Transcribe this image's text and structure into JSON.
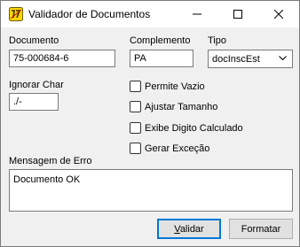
{
  "window": {
    "title": "Validador de Documentos",
    "icon": "app-logo-icon"
  },
  "titlebar_buttons": [
    "minimize-icon",
    "maximize-icon",
    "close-icon"
  ],
  "fields": {
    "documento": {
      "label": "Documento",
      "value": "75-000684-6"
    },
    "complemento": {
      "label": "Complemento",
      "value": "PA"
    },
    "tipo": {
      "label": "Tipo",
      "selected": "docInscEst"
    },
    "ignorar_char": {
      "label": "Ignorar Char",
      "value": "./-"
    }
  },
  "checkboxes": [
    {
      "label": "Permite Vazio",
      "checked": false
    },
    {
      "label": "Ajustar Tamanho",
      "checked": false
    },
    {
      "label": "Exibe Digito Calculado",
      "checked": false
    },
    {
      "label": "Gerar Exceção",
      "checked": false
    }
  ],
  "mensagem": {
    "label": "Mensagem de Erro",
    "value": "Documento OK"
  },
  "buttons": {
    "validar": {
      "rest": "alidar",
      "mnemonic": "V"
    },
    "formatar": "Formatar"
  }
}
